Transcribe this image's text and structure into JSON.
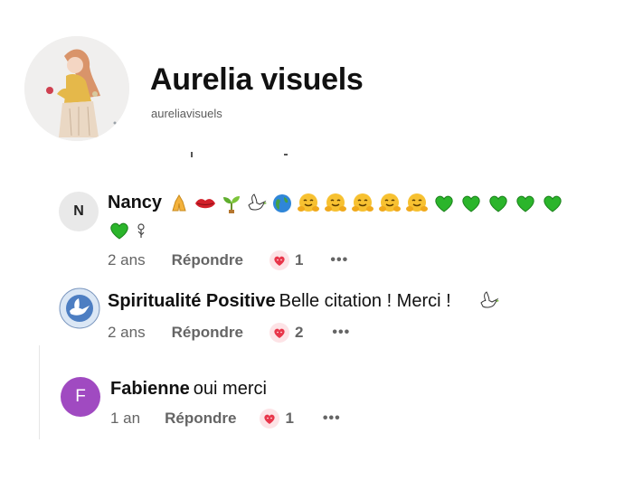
{
  "header": {
    "title": "Aurelia visuels",
    "handle": "aureliavisuels"
  },
  "comments": [
    {
      "avatar_letter": "N",
      "author": "Nancy",
      "text": "",
      "emojis": [
        "folded-hands",
        "red-lips",
        "seedling",
        "dove",
        "globe",
        "hugging-face",
        "hugging-face",
        "hugging-face",
        "hugging-face",
        "hugging-face",
        "green-heart",
        "green-heart",
        "green-heart",
        "green-heart",
        "green-heart",
        "green-heart",
        "flower"
      ],
      "time": "2 ans",
      "reply_label": "Répondre",
      "reaction_count": "1",
      "more_label": "•••"
    },
    {
      "avatar_icon": "dove-logo",
      "author": "Spiritualité Positive",
      "text": "Belle citation ! Merci !",
      "time": "2 ans",
      "reply_label": "Répondre",
      "reaction_count": "2",
      "more_label": "•••"
    },
    {
      "avatar_letter": "F",
      "author": "Fabienne",
      "text": "oui merci",
      "time": "1 an",
      "reply_label": "Répondre",
      "reaction_count": "1",
      "more_label": "•••"
    }
  ],
  "colors": {
    "heart_green": "#2bb52b",
    "reaction_bg": "#fde3e6",
    "avatar_purple": "#a04ac1",
    "meta_gray": "#656565"
  }
}
